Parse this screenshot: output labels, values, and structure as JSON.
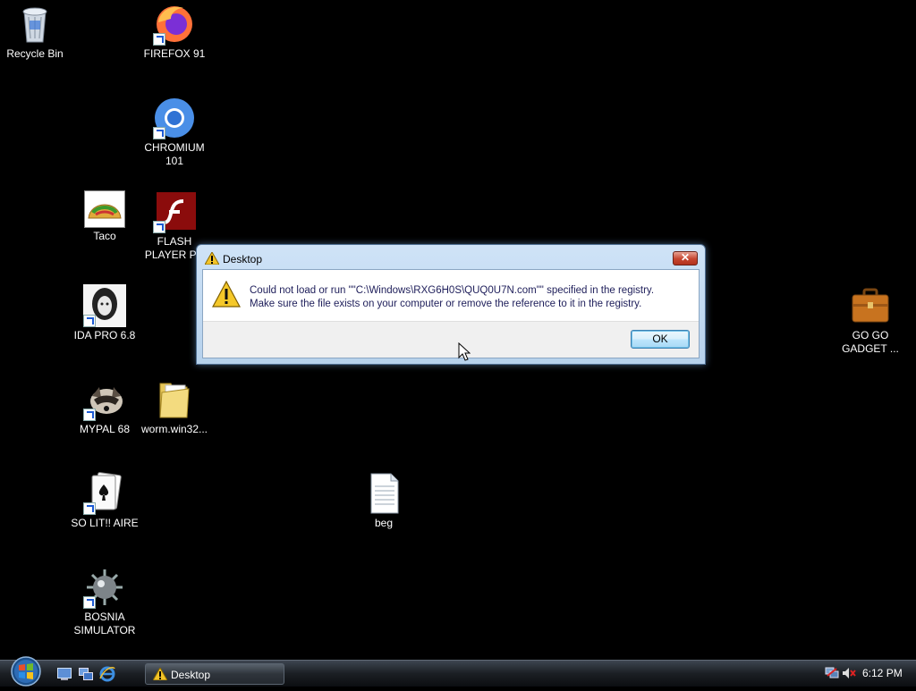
{
  "desktop": {
    "icons": [
      {
        "label": "Recycle Bin"
      },
      {
        "label": "FIREFOX 91"
      },
      {
        "label": "CHROMIUM\n101"
      },
      {
        "label": "Taco"
      },
      {
        "label": "FLASH\nPLAYER P..."
      },
      {
        "label": "IDA PRO 6.8"
      },
      {
        "label": "MYPAL 68"
      },
      {
        "label": "worm.win32..."
      },
      {
        "label": "SO LIT!! AIRE"
      },
      {
        "label": "BOSNIA\nSIMULATOR"
      },
      {
        "label": "beg"
      },
      {
        "label": "GO GO\nGADGET ..."
      }
    ]
  },
  "dialog": {
    "title": "Desktop",
    "close_label": "✕",
    "message_line1": "Could not load or run \"\"C:\\Windows\\RXG6H0S\\QUQ0U7N.com\"\" specified in the registry.",
    "message_line2": "Make sure the file exists on your computer or remove the reference to it in the registry.",
    "ok_label": "OK"
  },
  "taskbar": {
    "task_label": "Desktop",
    "clock": "6:12 PM"
  },
  "colors": {
    "desktop_bg": "#000000",
    "dialog_accent": "#b6d1ec",
    "ok_border": "#3c7fb1"
  }
}
